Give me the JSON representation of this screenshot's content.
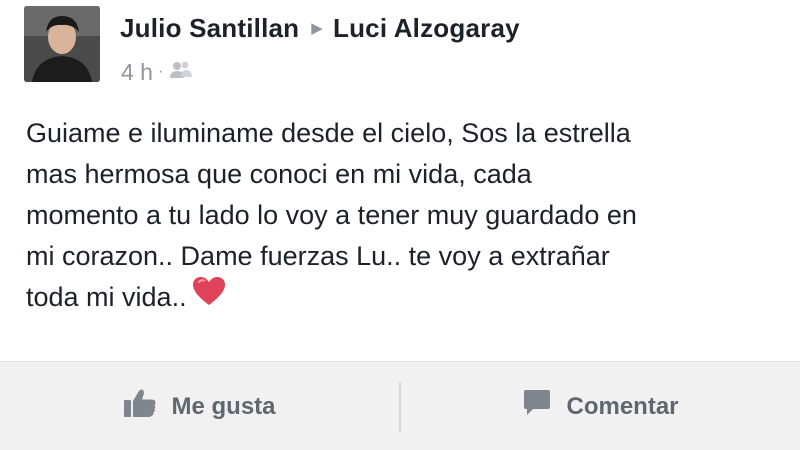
{
  "post": {
    "author": "Julio Santillan",
    "recipient": "Luci Alzogaray",
    "time": "4 h",
    "audience_icon": "friends-icon",
    "text_lines": [
      "Guiame e iluminame desde el cielo, Sos la estrella",
      "mas hermosa que conoci en mi vida, cada",
      "momento a tu lado lo voy a tener muy guardado en",
      "mi corazon.. Dame fuerzas Lu.. te voy a extrañar",
      "toda mi vida.."
    ],
    "emoji": "heart-icon"
  },
  "actions": {
    "like_label": "Me gusta",
    "comment_label": "Comentar"
  },
  "colors": {
    "text": "#1d2129",
    "secondary": "#90949c",
    "action_text": "#606770",
    "action_bar_bg": "#f1f1f2",
    "heart": "#e0425a"
  }
}
